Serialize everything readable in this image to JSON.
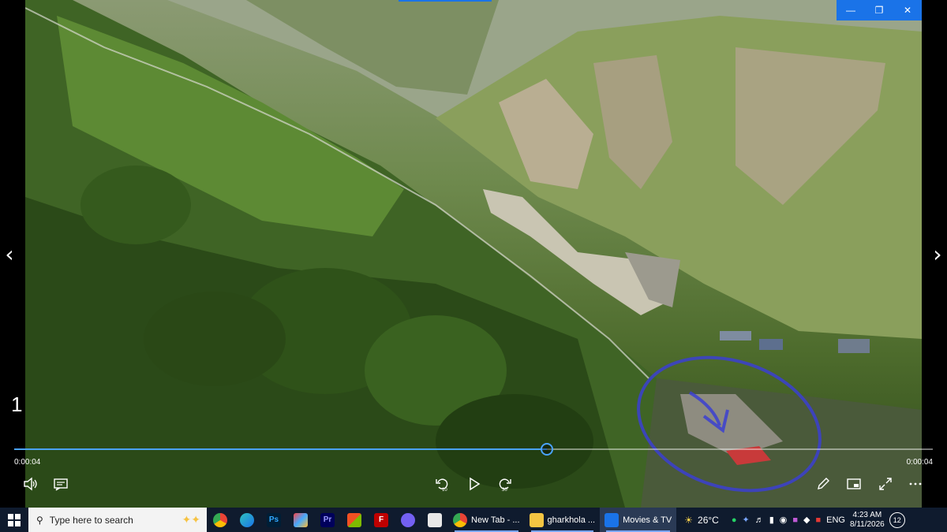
{
  "window": {
    "controls": {
      "minimize": "—",
      "restore": "❐",
      "close": "✕"
    }
  },
  "viewer": {
    "photo_index": "1",
    "nav_prev": "‹",
    "nav_next": "›"
  },
  "player": {
    "current_time": "0:00:04",
    "duration": "0:00:04",
    "progress": 0.58,
    "skip_back_label": "10",
    "skip_forward_label": "30"
  },
  "taskbar": {
    "search_placeholder": "Type here to search",
    "apps": [
      {
        "name": "chrome",
        "label": "New Tab - ..."
      },
      {
        "name": "file-explorer",
        "label": "gharkhola ..."
      },
      {
        "name": "movies-tv",
        "label": "Movies & TV"
      }
    ],
    "pinned": [
      {
        "name": "chrome-pinned",
        "text": ""
      },
      {
        "name": "edge-pinned",
        "text": ""
      },
      {
        "name": "photoshop-pinned",
        "text": "Ps"
      },
      {
        "name": "paint-pinned",
        "text": ""
      },
      {
        "name": "premiere-pinned",
        "text": "Pr"
      },
      {
        "name": "store-pinned",
        "text": ""
      },
      {
        "name": "filezilla-pinned",
        "text": ""
      },
      {
        "name": "viber-pinned",
        "text": ""
      },
      {
        "name": "notepad-pinned",
        "text": ""
      }
    ],
    "weather": "26°C",
    "language": "ENG",
    "time": "4:23 AM",
    "date": "8/11/2026",
    "notifications": "12"
  },
  "colors": {
    "accent": "#1a73e8",
    "seek": "#4aa3ff",
    "annotation": "#3b3fd1",
    "taskbar": "#0f1b2e"
  }
}
